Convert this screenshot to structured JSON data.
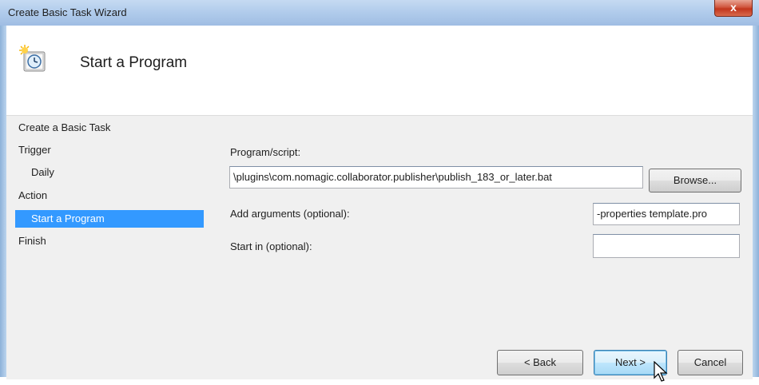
{
  "window": {
    "title": "Create Basic Task Wizard",
    "close_label": "x"
  },
  "header": {
    "title": "Start a Program",
    "icon": "scheduled-task-clock-icon"
  },
  "nav": {
    "items": [
      {
        "label": "Create a Basic Task"
      },
      {
        "label": "Trigger"
      },
      {
        "label": "Daily"
      },
      {
        "label": "Action"
      },
      {
        "label": "Start a Program",
        "selected": true
      },
      {
        "label": "Finish"
      }
    ]
  },
  "form": {
    "program_label": "Program/script:",
    "program_value": "\\plugins\\com.nomagic.collaborator.publisher\\publish_183_or_later.bat",
    "browse_label": "Browse...",
    "arguments_label": "Add arguments (optional):",
    "arguments_value": "-properties template.pro",
    "startin_label": "Start in (optional):",
    "startin_value": ""
  },
  "buttons": {
    "back": "< Back",
    "next": "Next >",
    "cancel": "Cancel"
  },
  "colors": {
    "selection": "#3399ff",
    "titlebar": "#b0cbeb",
    "close": "#c2361d"
  }
}
